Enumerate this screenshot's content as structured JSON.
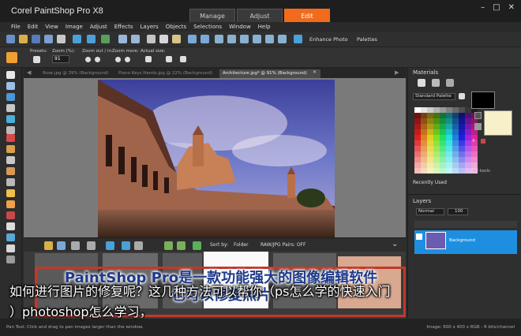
{
  "app": {
    "title": "Corel PaintShop Pro X8",
    "workspace_tabs": [
      {
        "label": "Manage"
      },
      {
        "label": "Adjust"
      },
      {
        "label": "Edit"
      }
    ],
    "window_buttons": [
      "–",
      "□",
      "✕"
    ]
  },
  "menu": [
    "File",
    "Edit",
    "View",
    "Image",
    "Adjust",
    "Effects",
    "Layers",
    "Objects",
    "Selections",
    "Window",
    "Help"
  ],
  "toolbar": {
    "enhance_photo": "Enhance Photo",
    "palettes": "Palettes"
  },
  "options": {
    "presets_label": "Presets:",
    "zoom_label": "Zoom (%):",
    "zoom_value": "91",
    "zoom_out_label": "Zoom out / in:",
    "zoom_more_label": "Zoom more:",
    "actual_size_label": "Actual size:"
  },
  "documents": {
    "tabs": [
      {
        "label": "Rose.jpg @  39% (Background)"
      },
      {
        "label": "Piano Keys Hands.jpg @  22% (Background)"
      },
      {
        "label": "Architecture.jpg* @  91% (Background)"
      }
    ]
  },
  "organizer": {
    "sort_by_label": "Sort by:",
    "sort_value": "Folder",
    "raw_jpg_pairs": "RAW/JPG Pairs: OFF"
  },
  "materials": {
    "title": "Materials",
    "palette_select": "Standard Palette",
    "all_tools": "All tools",
    "recently_used": "Recently Used",
    "foreground_color": "#000000",
    "background_color": "#f7f0c8"
  },
  "layers": {
    "title": "Layers",
    "blend_mode": "Normal",
    "opacity": "100",
    "layer_name": "Background"
  },
  "status": {
    "left": "Pan Tool: Click and drag to pan images larger than the window.",
    "right": "Image: 600 x 400 x RGB - 8 bits/channel"
  },
  "overlay": {
    "title_line1": "PaintShop Pro是一款功能强大的图像编辑软件",
    "title_line2": "也可以修复照片"
  },
  "caption": {
    "line1": "如何进行图片的修复呢？这几种方法可以帮你（ps怎么学的快速入门",
    "line2": "）photoshop怎么学习，"
  }
}
